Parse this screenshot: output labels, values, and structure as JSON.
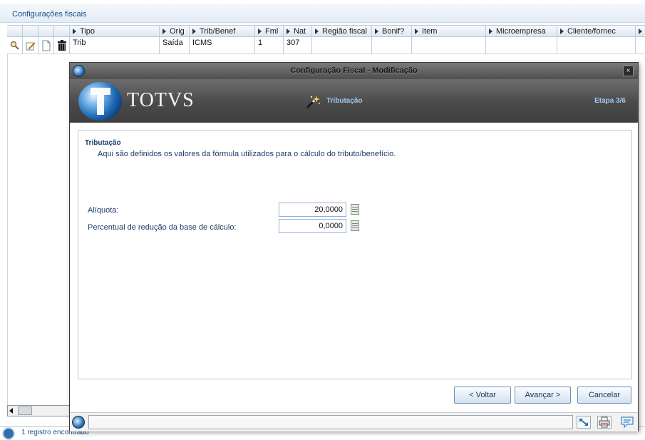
{
  "panel": {
    "title": "Configurações fiscais"
  },
  "grid": {
    "columns": [
      "Tipo",
      "Orig",
      "Trib/Benef",
      "Fml",
      "Nat",
      "Região fiscal",
      "Bonif?",
      "Item",
      "Microempresa",
      "Cliente/fornec"
    ],
    "rows": [
      {
        "tipo": "Trib",
        "orig": "Saída",
        "trib_benef": "ICMS",
        "fml": "1",
        "nat": "307",
        "regiao_fiscal": "",
        "bonif": "",
        "item": "",
        "microempresa": "",
        "cliente_fornec": ""
      }
    ],
    "row_actions": [
      "search-icon",
      "edit-icon",
      "copy-icon",
      "delete-icon"
    ]
  },
  "status": {
    "text": "1 registro encontrado"
  },
  "modal": {
    "title": "Configuração Fiscal - Modificação",
    "brand": "TOTVS",
    "step_name": "Tributação",
    "step_count": "Etapa 3/6",
    "section_title": "Tributação",
    "section_description": "Aqui são definidos os valores da fórmula utilizados para o cálculo do tributo/benefício.",
    "fields": [
      {
        "label": "Alíquota:",
        "value": "20,0000"
      },
      {
        "label": "Percentual de redução da base de cálculo:",
        "value": "0,0000"
      }
    ],
    "buttons": {
      "back": "< Voltar",
      "next": "Avançar >",
      "cancel": "Cancelar"
    },
    "close_label": "×",
    "footer_icons": [
      "resize-icon",
      "print-icon",
      "chat-icon"
    ]
  }
}
